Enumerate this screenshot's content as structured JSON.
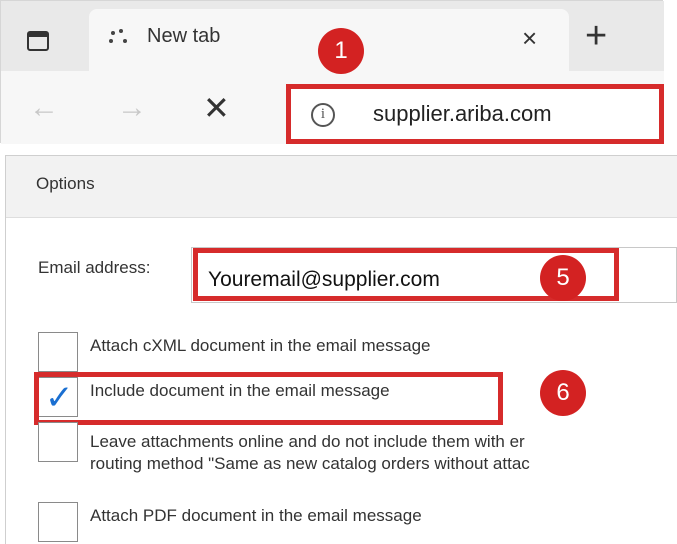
{
  "browser": {
    "tab_title": "New tab",
    "tab_close": "×",
    "new_tab": "+",
    "nav_back": "←",
    "nav_forward": "→",
    "nav_stop": "✕",
    "address": "supplier.ariba.com",
    "info_symbol": "i"
  },
  "annotations": {
    "badge1": "1",
    "badge5": "5",
    "badge6": "6",
    "highlight_color": "#d62b2b",
    "badge_color": "#d32222"
  },
  "options": {
    "title": "Options",
    "email_label": "Email address:",
    "email_value": "Youremail@supplier.com",
    "items": [
      {
        "label": "Attach cXML document in the email message",
        "checked": false
      },
      {
        "label": "Include document in the email message",
        "checked": true
      },
      {
        "label_line1": "Leave attachments online and do not include them with er",
        "label_line2": "routing method \"Same as new catalog orders without attac",
        "checked": false
      },
      {
        "label": "Attach PDF document in the email message",
        "checked": false
      }
    ],
    "check_symbol": "✓"
  }
}
